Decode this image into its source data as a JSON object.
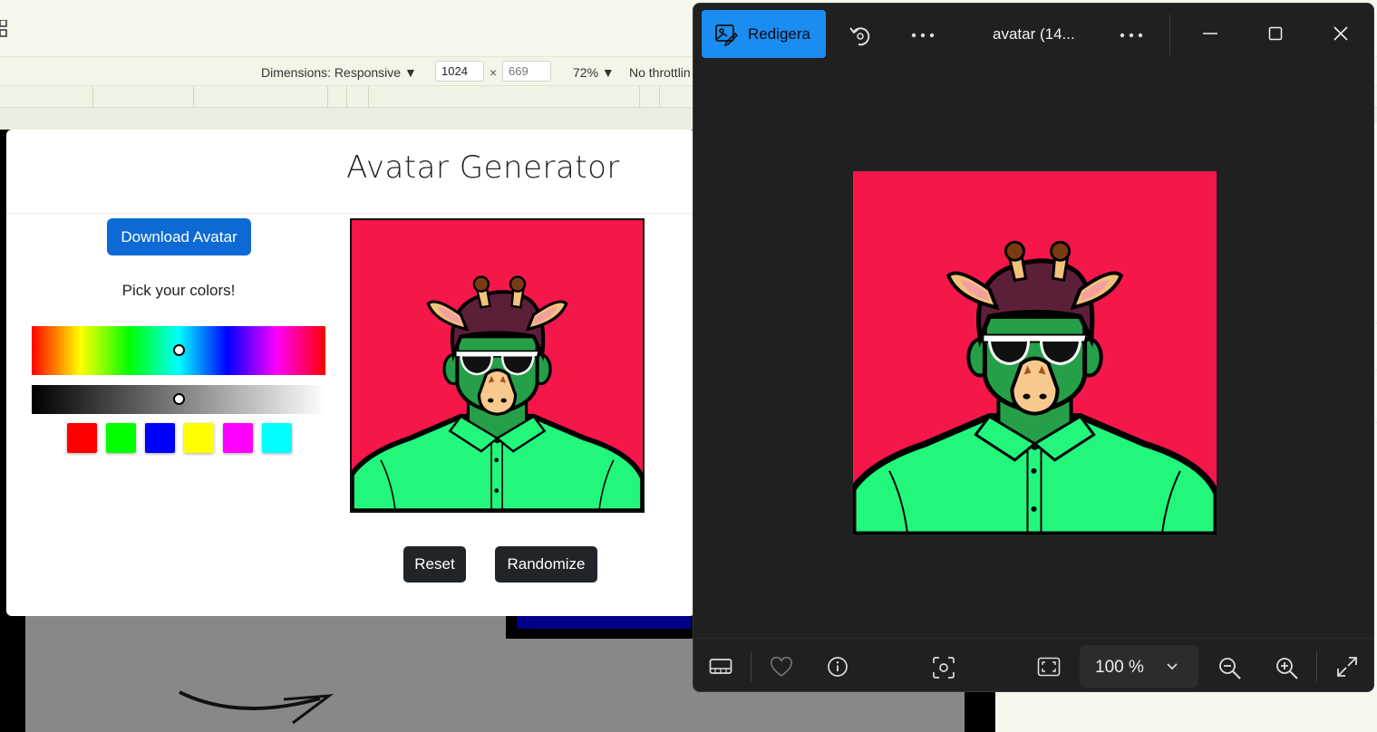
{
  "devtools": {
    "dimensions_label": "Dimensions: Responsive",
    "width_value": "1024",
    "height_placeholder": "669",
    "times": "×",
    "zoom_label": "72%",
    "throttling_label": "No throttlin"
  },
  "app": {
    "title": "Avatar Generator",
    "download_label": "Download Avatar",
    "pick_label": "Pick your colors!",
    "reset_label": "Reset",
    "randomize_label": "Randomize",
    "hue_level": 0.5,
    "lightness_level": 0.5,
    "swatches": [
      "#ff0000",
      "#00ff00",
      "#0000ff",
      "#ffff00",
      "#ff00ff",
      "#00ffff"
    ],
    "avatar_colors": {
      "background": "#f5164a",
      "skin": "#25a048",
      "shirt": "#22f77c",
      "hair": "#5c1f3a",
      "snout": "#f7c98c",
      "ears": "#f2c27a"
    }
  },
  "viewer": {
    "edit_label": "Redigera",
    "title": "avatar (14...",
    "zoom_value": "100 %"
  }
}
